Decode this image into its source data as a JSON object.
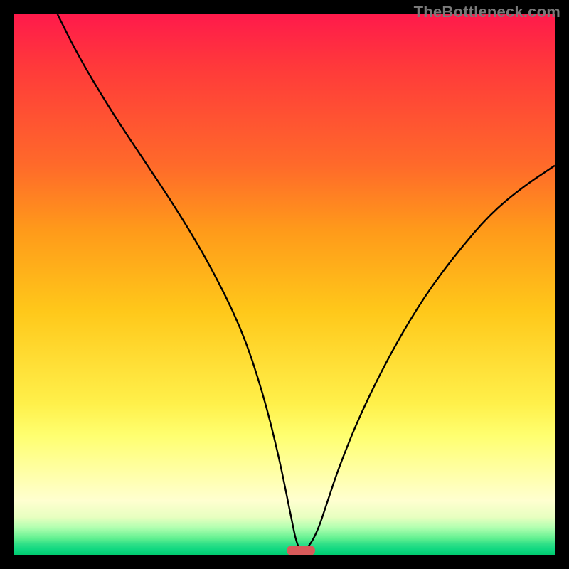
{
  "watermark": "TheBottleneck.com",
  "chart_data": {
    "type": "line",
    "title": "",
    "xlabel": "",
    "ylabel": "",
    "xlim": [
      0,
      100
    ],
    "ylim": [
      0,
      100
    ],
    "series": [
      {
        "name": "curve",
        "x": [
          8,
          12,
          18,
          24,
          30,
          36,
          42,
          46,
          49,
          51,
          52.5,
          54,
          56,
          58,
          60,
          64,
          70,
          76,
          82,
          88,
          94,
          100
        ],
        "values": [
          100,
          92,
          82,
          73,
          64,
          54,
          42,
          30,
          18,
          8,
          0.8,
          0.8,
          4,
          10,
          16,
          26,
          38,
          48,
          56,
          63,
          68,
          72
        ]
      }
    ],
    "marker": {
      "x": 53,
      "y": 0.8,
      "color": "#d85a5a"
    },
    "gradient_stops": [
      {
        "pos": 0,
        "color": "#ff1a4b"
      },
      {
        "pos": 50,
        "color": "#ffd020"
      },
      {
        "pos": 80,
        "color": "#ffff80"
      },
      {
        "pos": 100,
        "color": "#00cc70"
      }
    ]
  }
}
